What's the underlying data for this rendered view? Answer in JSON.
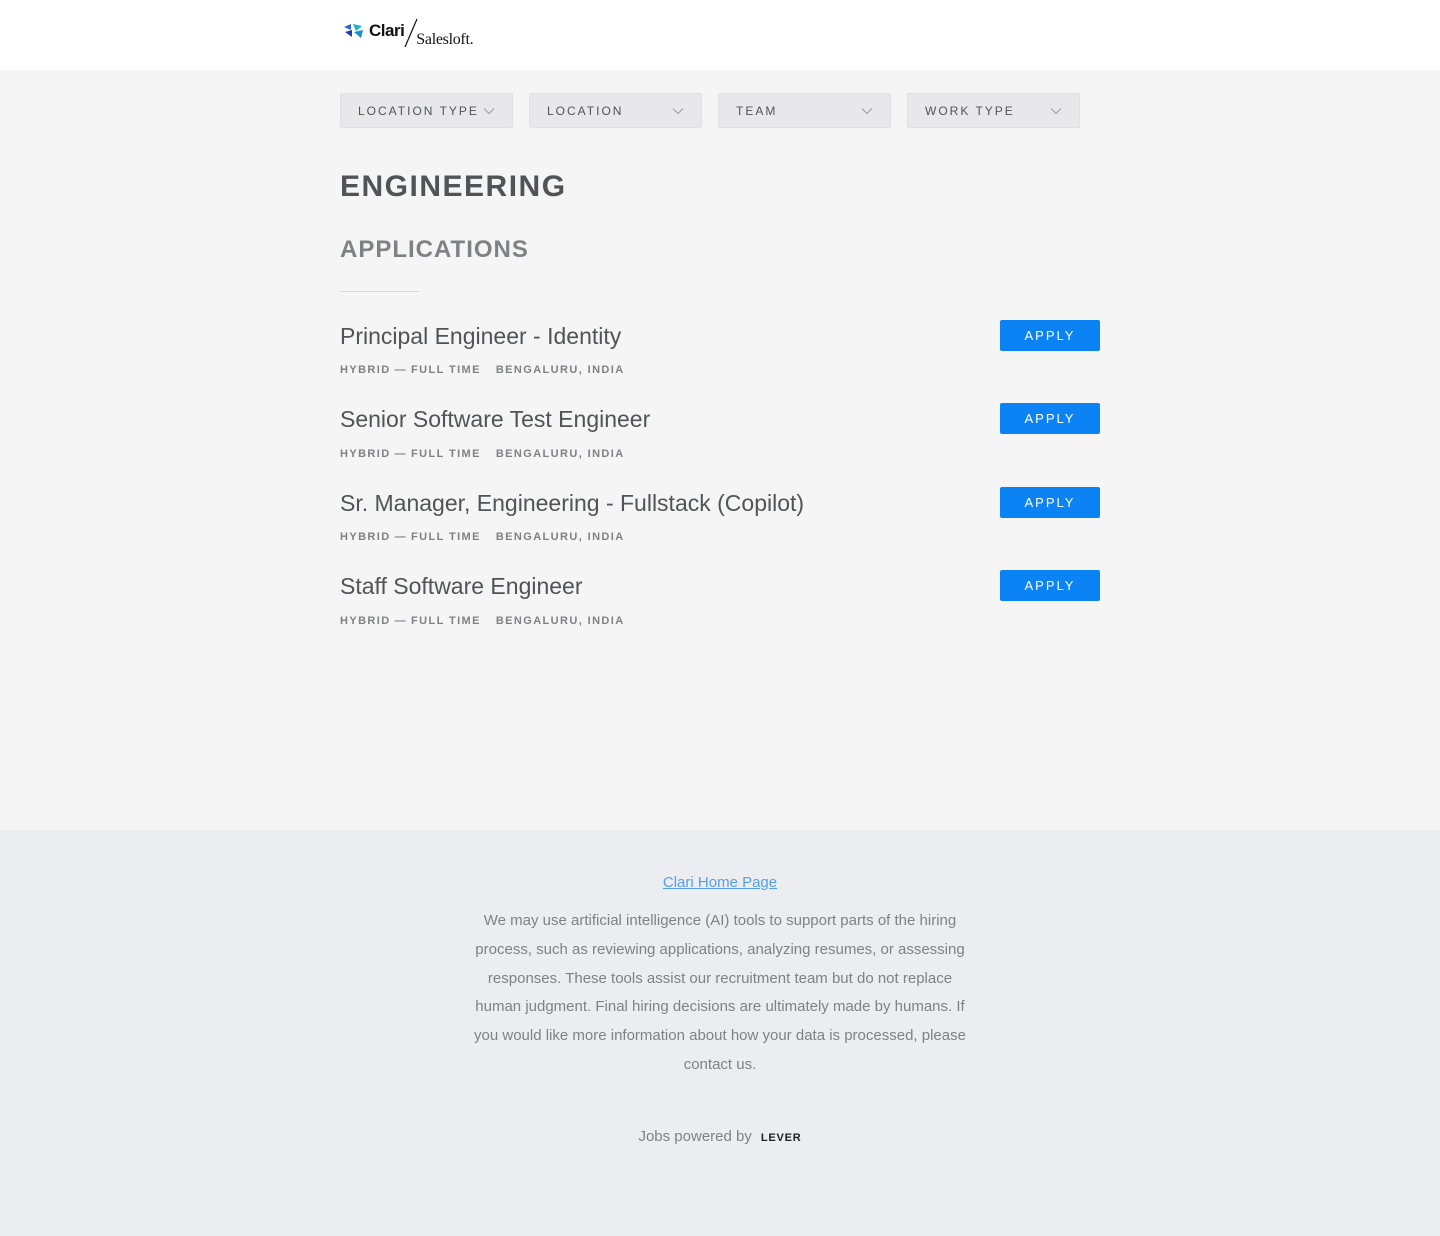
{
  "header": {
    "logo_clari": "Clari",
    "logo_salesloft": "Salesloft."
  },
  "filters": [
    {
      "label": "LOCATION TYPE"
    },
    {
      "label": "LOCATION"
    },
    {
      "label": "TEAM"
    },
    {
      "label": "WORK TYPE"
    }
  ],
  "department": "ENGINEERING",
  "group": "APPLICATIONS",
  "postings": [
    {
      "title": "Principal Engineer - Identity",
      "location_type": "HYBRID",
      "separator": "—",
      "commitment": "FULL TIME",
      "location": "BENGALURU, INDIA",
      "apply": "APPLY"
    },
    {
      "title": "Senior Software Test Engineer",
      "location_type": "HYBRID",
      "separator": "—",
      "commitment": "FULL TIME",
      "location": "BENGALURU, INDIA",
      "apply": "APPLY"
    },
    {
      "title": "Sr. Manager, Engineering - Fullstack (Copilot)",
      "location_type": "HYBRID",
      "separator": "—",
      "commitment": "FULL TIME",
      "location": "BENGALURU, INDIA",
      "apply": "APPLY"
    },
    {
      "title": "Staff Software Engineer",
      "location_type": "HYBRID",
      "separator": "—",
      "commitment": "FULL TIME",
      "location": "BENGALURU, INDIA",
      "apply": "APPLY"
    }
  ],
  "footer": {
    "home_link": "Clari Home Page",
    "disclaimer": "We may use artificial intelligence (AI) tools to support parts of the hiring process, such as reviewing applications, analyzing resumes, or assessing responses. These tools assist our recruitment team but do not replace human judgment. Final hiring decisions are ultimately made by humans. If you would like more information about how your data is processed, please contact us.",
    "powered_by": "Jobs powered by",
    "lever": "LEVER"
  },
  "colors": {
    "accent": "#0c83f5",
    "link": "#579eea",
    "page_bg": "#f5f5f6",
    "footer_bg": "#ecedf0"
  }
}
